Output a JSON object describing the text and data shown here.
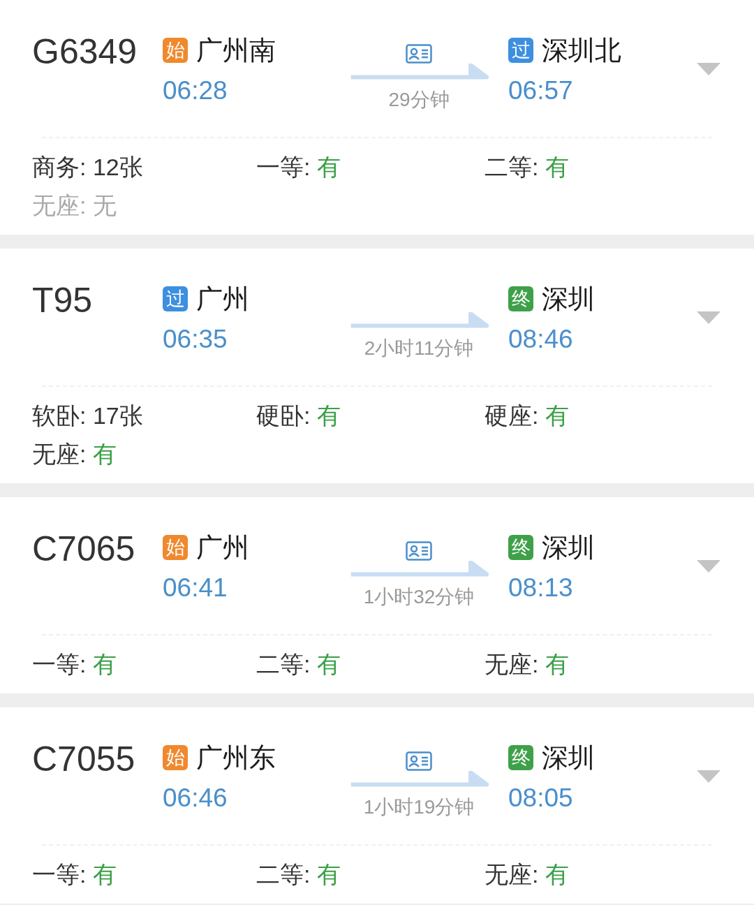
{
  "trains": [
    {
      "number": "G6349",
      "id_icon": true,
      "from": {
        "kind": "start",
        "badge": "始",
        "station": "广州南",
        "time": "06:28"
      },
      "duration": "29分钟",
      "to": {
        "kind": "pass",
        "badge": "过",
        "station": "深圳北",
        "time": "06:57"
      },
      "seats": [
        {
          "label": "商务:",
          "value": "12张",
          "kind": "count"
        },
        {
          "label": "一等:",
          "value": "有",
          "kind": "yes"
        },
        {
          "label": "二等:",
          "value": "有",
          "kind": "yes"
        },
        {
          "label": "无座:",
          "value": "无",
          "kind": "no"
        }
      ]
    },
    {
      "number": "T95",
      "id_icon": false,
      "from": {
        "kind": "pass",
        "badge": "过",
        "station": "广州",
        "time": "06:35"
      },
      "duration": "2小时11分钟",
      "to": {
        "kind": "end",
        "badge": "终",
        "station": "深圳",
        "time": "08:46"
      },
      "seats": [
        {
          "label": "软卧:",
          "value": "17张",
          "kind": "count"
        },
        {
          "label": "硬卧:",
          "value": "有",
          "kind": "yes"
        },
        {
          "label": "硬座:",
          "value": "有",
          "kind": "yes"
        },
        {
          "label": "无座:",
          "value": "有",
          "kind": "yes"
        }
      ]
    },
    {
      "number": "C7065",
      "id_icon": true,
      "from": {
        "kind": "start",
        "badge": "始",
        "station": "广州",
        "time": "06:41"
      },
      "duration": "1小时32分钟",
      "to": {
        "kind": "end",
        "badge": "终",
        "station": "深圳",
        "time": "08:13"
      },
      "seats": [
        {
          "label": "一等:",
          "value": "有",
          "kind": "yes"
        },
        {
          "label": "二等:",
          "value": "有",
          "kind": "yes"
        },
        {
          "label": "无座:",
          "value": "有",
          "kind": "yes"
        }
      ]
    },
    {
      "number": "C7055",
      "id_icon": true,
      "from": {
        "kind": "start",
        "badge": "始",
        "station": "广州东",
        "time": "06:46"
      },
      "duration": "1小时19分钟",
      "to": {
        "kind": "end",
        "badge": "终",
        "station": "深圳",
        "time": "08:05"
      },
      "seats": [
        {
          "label": "一等:",
          "value": "有",
          "kind": "yes"
        },
        {
          "label": "二等:",
          "value": "有",
          "kind": "yes"
        },
        {
          "label": "无座:",
          "value": "有",
          "kind": "yes"
        }
      ]
    }
  ]
}
